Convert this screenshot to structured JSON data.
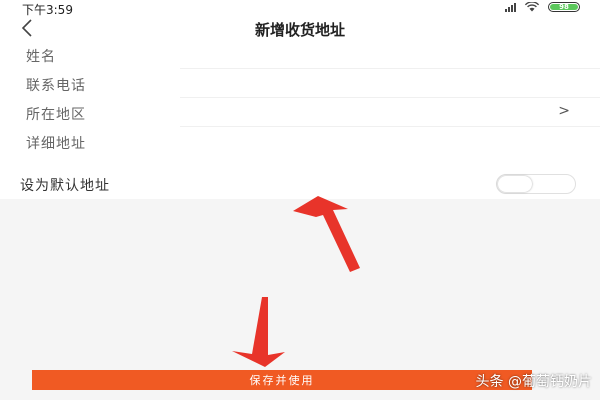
{
  "status_bar": {
    "time": "下午3:59",
    "battery": "98",
    "battery_color": "#5bc85b"
  },
  "nav": {
    "back_icon": "chevron-left-icon",
    "title": "新增收货地址"
  },
  "form": {
    "fields": [
      {
        "label": "姓名"
      },
      {
        "label": "联系电话"
      },
      {
        "label": "所在地区",
        "chevron": ">"
      },
      {
        "label": "详细地址"
      }
    ],
    "default_label": "设为默认地址",
    "default_on": false
  },
  "save_button": {
    "label": "保存并使用",
    "color": "#f05a23"
  },
  "annotation_arrow_color": "#e8342a",
  "watermark": "头条 @葡萄钙奶片"
}
